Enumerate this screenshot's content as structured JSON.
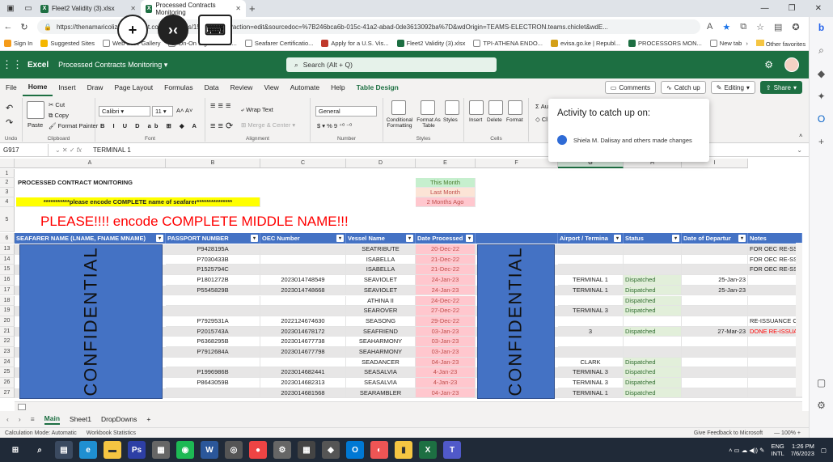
{
  "browser": {
    "tabs": [
      {
        "label": "Fleet2 Validity (3).xlsx"
      },
      {
        "label": "Processed Contracts Monitoring"
      }
    ],
    "url": "https://thenamaricoliz.sharepoint.com/:x:/r/sites/15/Doc.aspx?action=edit&sourcedoc=%7B246bca6b-015c-41a2-abad-0de3613092ba%7D&wdOrigin=TEAMS-ELECTRON.teams.chiclet&wdE...",
    "favorites": [
      "Sign In",
      "Suggested Sites",
      "Web Slice Gallery",
      "On-On Signers Trav...",
      "Seafarer Certificatio...",
      "Apply for a U.S. Vis...",
      "Fleet2 Validity (3).xlsx",
      "TPI-ATHENA ENDO...",
      "evisa.go.ke | Republ...",
      "PROCESSORS MON...",
      "New tab"
    ],
    "other_favorites": "Other favorites"
  },
  "excel": {
    "app_name": "Excel",
    "doc_name": "Processed Contracts Monitoring",
    "search_placeholder": "Search (Alt + Q)",
    "ribbon_tabs": [
      "File",
      "Home",
      "Insert",
      "Draw",
      "Page Layout",
      "Formulas",
      "Data",
      "Review",
      "View",
      "Automate",
      "Help",
      "Table Design"
    ],
    "comments_label": "Comments",
    "catchup_label": "Catch up",
    "editing_label": "Editing",
    "share_label": "Share",
    "ribbon": {
      "paste": "Paste",
      "cut": "Cut",
      "copy": "Copy",
      "format_painter": "Format Painter",
      "font_name": "Calibri",
      "font_size": "11",
      "wrap_text": "Wrap Text",
      "merge_center": "Merge & Center",
      "number_format": "General",
      "conditional": "Conditional Formatting",
      "format_as": "Format As Table",
      "styles": "Styles",
      "insert": "Insert",
      "delete": "Delete",
      "format": "Format",
      "groups": [
        "Undo",
        "Clipboard",
        "Font",
        "Alignment",
        "Number",
        "Styles",
        "Cells"
      ]
    },
    "popup": {
      "title": "Activity to catch up on:",
      "row": "Shiela M. Dalisay and others made changes"
    },
    "name_box": "G917",
    "formula": "TERMINAL 1"
  },
  "sheet": {
    "columns": [
      "A",
      "B",
      "C",
      "D",
      "E",
      "F",
      "G",
      "H",
      "I"
    ],
    "selected_column": "G",
    "top_rows": [
      "1",
      "2",
      "3",
      "4",
      "5"
    ],
    "title": "PROCESSED CONTRACT MONITORING",
    "note_yellow": "***********please encode COMPLETE name of seafarer***************",
    "note_red": "PLEASE!!!! encode COMPLETE MIDDLE NAME!!!",
    "legend": [
      "This Month",
      "Last Month",
      "2 Months Ago"
    ],
    "header_row_num": "6",
    "headers": [
      "SEAFARER NAME (LNAME, FNAME MNAME)",
      "PASSPORT NUMBER",
      "OEC Number",
      "Vessel Name",
      "Date Processed",
      "",
      "Airport / Termina",
      "Status",
      "Date of Departur",
      "Notes"
    ],
    "confidential": "CONFIDENTIAL",
    "rows": [
      {
        "num": "13",
        "passport": "P9428195A",
        "oec": "",
        "vessel": "SEATRIBUTE",
        "date": "20-Dec-22",
        "airport": "",
        "status": "",
        "dep": "",
        "notes": "FOR OEC RE-SSUAI",
        "notes_red": false
      },
      {
        "num": "14",
        "passport": "P7030433B",
        "oec": "",
        "vessel": "ISABELLA",
        "date": "21-Dec-22",
        "airport": "",
        "status": "",
        "dep": "",
        "notes": "FOR OEC RE-SSUAI",
        "notes_red": false
      },
      {
        "num": "15",
        "passport": "P1525794C",
        "oec": "",
        "vessel": "ISABELLA",
        "date": "21-Dec-22",
        "airport": "",
        "status": "",
        "dep": "",
        "notes": "FOR OEC RE-SSUAI",
        "notes_red": false
      },
      {
        "num": "16",
        "passport": "P1801272B",
        "oec": "2023014748549",
        "vessel": "SEAVIOLET",
        "date": "24-Jan-23",
        "airport": "TERMINAL 1",
        "status": "Dispatched",
        "dep": "25-Jan-23",
        "notes": "",
        "notes_red": false
      },
      {
        "num": "17",
        "passport": "P5545829B",
        "oec": "2023014748668",
        "vessel": "SEAVIOLET",
        "date": "24-Jan-23",
        "airport": "TERMINAL 1",
        "status": "Dispatched",
        "dep": "25-Jan-23",
        "notes": "",
        "notes_red": false
      },
      {
        "num": "18",
        "passport": "",
        "oec": "",
        "vessel": "ATHINA II",
        "date": "24-Dec-22",
        "airport": "",
        "status": "Dispatched",
        "dep": "",
        "notes": "",
        "notes_red": false
      },
      {
        "num": "19",
        "passport": "",
        "oec": "",
        "vessel": "SEAROVER",
        "date": "27-Dec-22",
        "airport": "TERMINAL 3",
        "status": "Dispatched",
        "dep": "",
        "notes": "",
        "notes_red": false
      },
      {
        "num": "20",
        "passport": "P7929531A",
        "oec": "2022124674630",
        "vessel": "SEASONG",
        "date": "29-Dec-22",
        "airport": "",
        "status": "",
        "dep": "",
        "notes": "RE-ISSUANCE OEC",
        "notes_red": false
      },
      {
        "num": "21",
        "passport": "P2015743A",
        "oec": "2023014678172",
        "vessel": "SEAFRIEND",
        "date": "03-Jan-23",
        "airport": "3",
        "status": "Dispatched",
        "dep": "27-Mar-23",
        "notes": "DONE RE-ISSUANC",
        "notes_red": true
      },
      {
        "num": "22",
        "passport": "P6368295B",
        "oec": "2023014677738",
        "vessel": "SEAHARMONY",
        "date": "03-Jan-23",
        "airport": "",
        "status": "",
        "dep": "",
        "notes": "",
        "notes_red": false
      },
      {
        "num": "23",
        "passport": "P7912684A",
        "oec": "2023014677798",
        "vessel": "SEAHARMONY",
        "date": "03-Jan-23",
        "airport": "",
        "status": "",
        "dep": "",
        "notes": "",
        "notes_red": false
      },
      {
        "num": "24",
        "passport": "",
        "oec": "",
        "vessel": "SEADANCER",
        "date": "04-Jan-23",
        "airport": "CLARK",
        "status": "Dispatched",
        "dep": "",
        "notes": "",
        "notes_red": false
      },
      {
        "num": "25",
        "passport": "P1996986B",
        "oec": "2023014682441",
        "vessel": "SEASALVIA",
        "date": "4-Jan-23",
        "airport": "TERMINAL 3",
        "status": "Dispatched",
        "dep": "",
        "notes": "",
        "notes_red": false
      },
      {
        "num": "26",
        "passport": "P8643059B",
        "oec": "2023014682313",
        "vessel": "SEASALVIA",
        "date": "4-Jan-23",
        "airport": "TERMINAL 3",
        "status": "Dispatched",
        "dep": "",
        "notes": "",
        "notes_red": false
      },
      {
        "num": "27",
        "passport": "",
        "oec": "2023014681568",
        "vessel": "SEARAMBLER",
        "date": "04-Jan-23",
        "airport": "TERMINAL 1",
        "status": "Dispatched",
        "dep": "",
        "notes": "",
        "notes_red": false
      }
    ],
    "sheet_tabs": [
      "Main",
      "Sheet1",
      "DropDowns"
    ]
  },
  "status_bar": {
    "calc_mode": "Calculation Mode: Automatic",
    "workbook_stats": "Workbook Statistics",
    "feedback": "Give Feedback to Microsoft",
    "zoom": "100%"
  },
  "taskbar": {
    "lang1": "ENG",
    "lang2": "INTL",
    "time": "1:26 PM",
    "date": "7/6/2023"
  },
  "colors": {
    "excel_green": "#1d6f42",
    "header_blue": "#4472c4",
    "this_month": "#c6efce",
    "last_month": "#fce4d6",
    "two_months": "#ffc7ce",
    "dispatched": "#e2efda",
    "yellow": "#ffff00",
    "red_text": "#ff0000"
  }
}
